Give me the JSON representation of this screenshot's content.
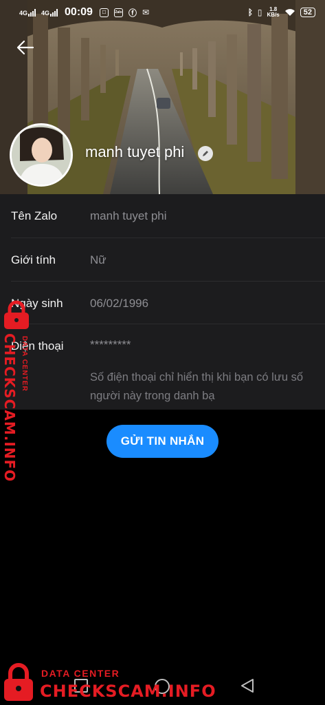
{
  "status_bar": {
    "signal_1": "4G",
    "signal_2": "4G",
    "time": "00:09",
    "zalo_icon_text": "Zalo",
    "net_speed_value": "1.8",
    "net_speed_unit": "KB/s",
    "battery": "52"
  },
  "profile": {
    "display_name": "manh tuyet phi"
  },
  "info": {
    "rows": [
      {
        "label": "Tên Zalo",
        "value": "manh tuyet phi"
      },
      {
        "label": "Giới tính",
        "value": "Nữ"
      },
      {
        "label": "Ngày sinh",
        "value": "06/02/1996"
      },
      {
        "label": "Điện thoại",
        "value": "*********"
      }
    ],
    "phone_note": "Số điện thoại chỉ hiển thị khi bạn có lưu số người này trong danh bạ"
  },
  "actions": {
    "send_message": "GỬI TIN NHẮN"
  },
  "watermark": {
    "small": "DATA CENTER",
    "big": "CHECKSCAM.INFO"
  },
  "colors": {
    "accent": "#1a8cff",
    "card_bg": "#1c1c1e",
    "watermark": "#e51c23"
  },
  "icons": [
    "back-arrow-icon",
    "edit-pencil-icon",
    "bluetooth-icon",
    "vibrate-icon",
    "wifi-icon",
    "battery-icon",
    "lock-icon",
    "nav-recent-icon",
    "nav-home-icon",
    "nav-back-icon"
  ]
}
